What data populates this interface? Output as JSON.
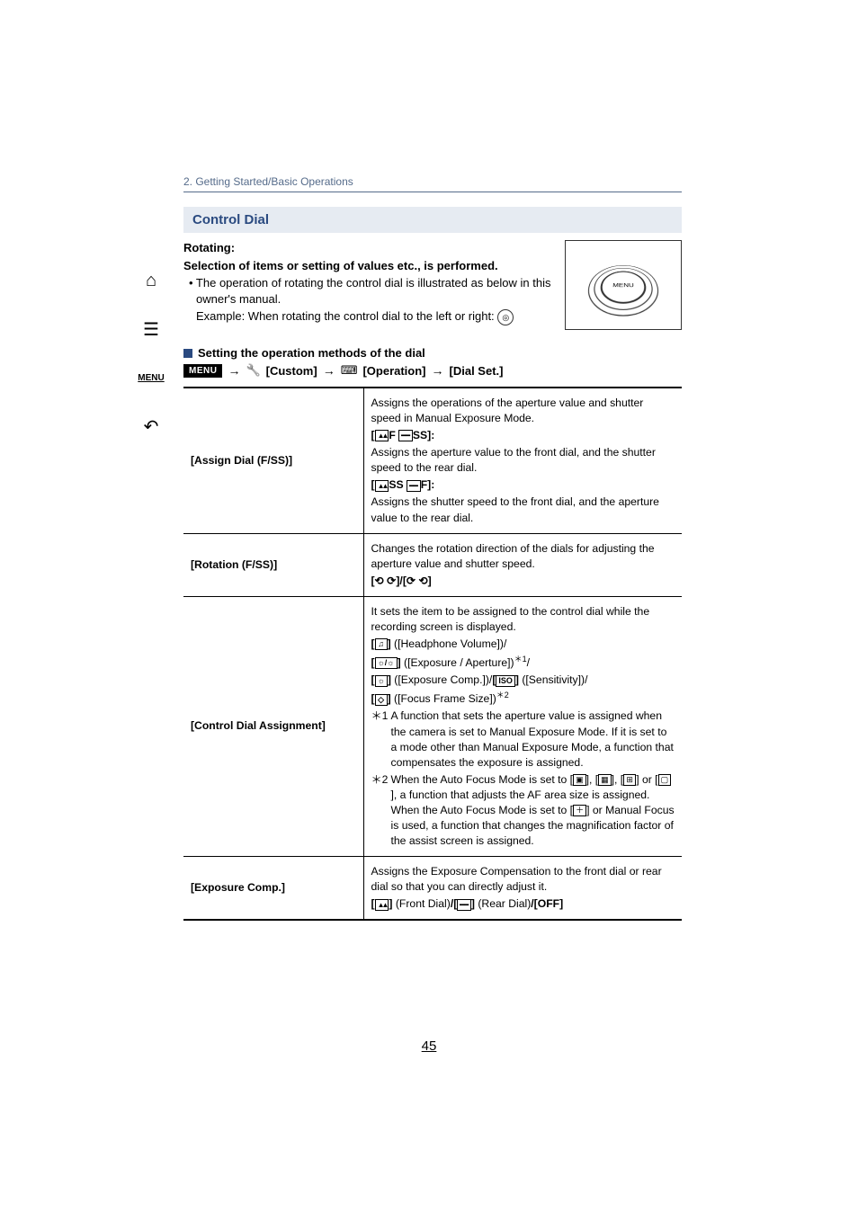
{
  "chapter": "2. Getting Started/Basic Operations",
  "sidebar": {
    "home": "⌂",
    "toc": "☰",
    "menu": "MENU",
    "back": "↶"
  },
  "section_title": "Control Dial",
  "rotating_label": "Rotating:",
  "rotating_desc": "Selection of items or setting of values etc., is performed.",
  "rotating_bullet": "• The operation of rotating the control dial is illustrated as below in this owner's manual.",
  "rotating_example_prefix": "Example: When rotating the control dial to the left or right:",
  "subsection_title": "Setting the operation methods of the dial",
  "menu_path": {
    "menu_badge": "MENU",
    "arrow": "→",
    "custom": "[Custom]",
    "operation": "[Operation]",
    "dial_set": "[Dial Set.]"
  },
  "table": {
    "rows": [
      {
        "label": "[Assign Dial (F/SS)]",
        "lines": [
          {
            "t": "Assigns the operations of the aperture value and shutter speed in Manual Exposure Mode."
          },
          {
            "t": "[▲F ━SS]:",
            "bold": true,
            "glyphs": true
          },
          {
            "t": "Assigns the aperture value to the front dial, and the shutter speed to the rear dial."
          },
          {
            "t": "[▲SS ━F]:",
            "bold": true,
            "glyphs": true
          },
          {
            "t": "Assigns the shutter speed to the front dial, and the aperture value to the rear dial."
          }
        ]
      },
      {
        "label": "[Rotation (F/SS)]",
        "lines": [
          {
            "t": "Changes the rotation direction of the dials for adjusting the aperture value and shutter speed."
          },
          {
            "t": "[⟲ ⟳]/[⟳ ⟲]",
            "bold": true
          }
        ]
      },
      {
        "label": "[Control Dial Assignment]",
        "lines": [
          {
            "t": "It sets the item to be assigned to the control dial while the recording screen is displayed."
          },
          {
            "opt": "([Headphone Volume])/",
            "glyph": "♫"
          },
          {
            "opt": "([Exposure / Aperture])",
            "glyph": "☼/☼",
            "sup": "＊1",
            "trail": "/"
          },
          {
            "opt_double": true,
            "g1": "☼",
            "t1": "([Exposure Comp.])/",
            "g2": "ISO",
            "t2": "([Sensitivity])/"
          },
          {
            "opt": "([Focus Frame Size])",
            "glyph": "◇",
            "sup": "＊2"
          },
          {
            "note": "＊1",
            "t": "A function that sets the aperture value is assigned when the camera is set to Manual Exposure Mode. If it is set to a mode other than Manual Exposure Mode, a function that compensates the exposure is assigned."
          },
          {
            "note": "＊2",
            "t_parts": [
              "When the Auto Focus Mode is set to [",
              {
                "glyph": "▣"
              },
              "], [",
              {
                "glyph": "▦"
              },
              "], [",
              {
                "glyph": "⊞"
              },
              "] or [",
              {
                "glyph": "▢"
              },
              "], a function that adjusts the AF area size is assigned. When the Auto Focus Mode is set to [",
              {
                "glyph": "＋"
              },
              "] or Manual Focus is used, a function that changes the magnification factor of the assist screen is assigned."
            ]
          }
        ]
      },
      {
        "label": "[Exposure Comp.]",
        "lines": [
          {
            "t": "Assigns the Exposure Compensation to the front dial or rear dial so that you can directly adjust it."
          },
          {
            "ec_line": true,
            "front": "(Front Dial)",
            "sep": "/",
            "rear": "(Rear Dial)",
            "off": "[OFF]"
          }
        ]
      }
    ]
  },
  "page_number": "45"
}
